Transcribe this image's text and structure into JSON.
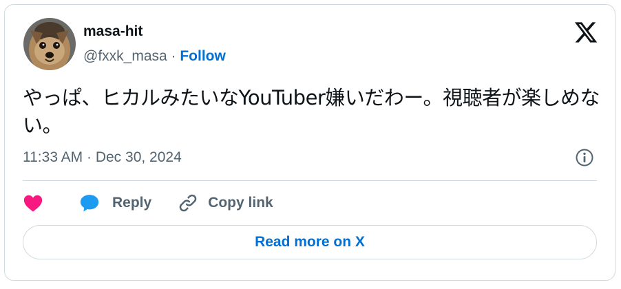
{
  "author": {
    "name": "masa-hit",
    "handle": "@fxxk_masa",
    "separator": " · ",
    "follow_label": "Follow",
    "avatar_icon": "dog-avatar"
  },
  "brand": {
    "logo_icon": "x-logo-icon"
  },
  "tweet": {
    "text": "やっぱ、ヒカルみたいなYouTuber嫌いだわー。視聴者が楽しめない。",
    "timestamp": "11:33 AM · Dec 30, 2024"
  },
  "actions": {
    "like_icon": "heart-icon",
    "reply_icon": "speech-bubble-icon",
    "reply_label": "Reply",
    "copy_icon": "link-icon",
    "copy_label": "Copy link"
  },
  "footer": {
    "read_more_label": "Read more on X"
  },
  "colors": {
    "link_blue": "#006fd6",
    "like_pink": "#f91880",
    "reply_blue": "#1d9bf0",
    "secondary_text": "#536471",
    "border": "#cfd9de"
  }
}
